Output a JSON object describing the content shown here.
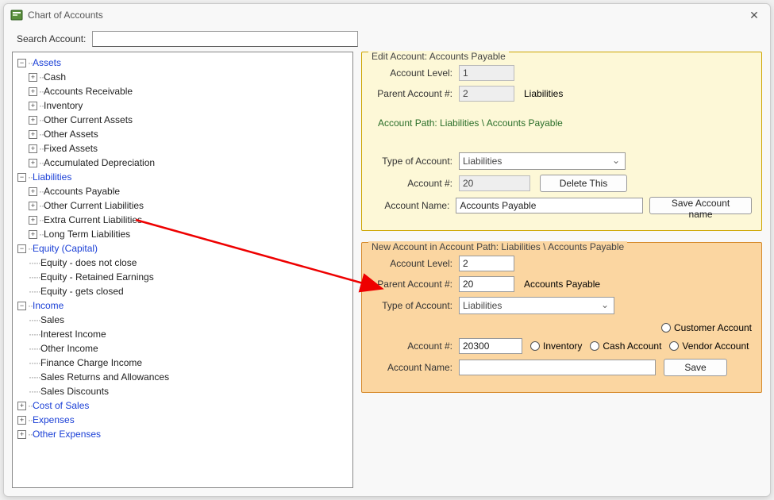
{
  "window": {
    "title": "Chart of Accounts"
  },
  "search": {
    "label": "Search Account:",
    "value": ""
  },
  "tree": {
    "assets": {
      "label": "Assets",
      "children": [
        "Cash",
        "Accounts Receivable",
        "Inventory",
        "Other Current Assets",
        "Other Assets",
        "Fixed Assets",
        "Accumulated Depreciation"
      ]
    },
    "liabilities": {
      "label": "Liabilities",
      "children": [
        "Accounts Payable",
        "Other Current Liabilities",
        "Extra Current Liabilities",
        "Long Term Liabilities"
      ]
    },
    "equity": {
      "label": "Equity (Capital)",
      "children": [
        "Equity - does not close",
        "Equity - Retained Earnings",
        "Equity - gets closed"
      ]
    },
    "income": {
      "label": "Income",
      "children": [
        "Sales",
        "Interest  Income",
        "Other Income",
        "Finance Charge Income",
        "Sales Returns and Allowances",
        "Sales Discounts"
      ]
    },
    "cost_of_sales": {
      "label": "Cost of Sales"
    },
    "expenses": {
      "label": "Expenses"
    },
    "other_expenses": {
      "label": "Other Expenses"
    }
  },
  "edit": {
    "legend": "Edit Account: Accounts Payable",
    "level_label": "Account Level:",
    "level": "1",
    "parent_label": "Parent Account #:",
    "parent_num": "2",
    "parent_name": "Liabilities",
    "path_label": "Account Path:  Liabilities \\ Accounts Payable",
    "type_label": "Type of Account:",
    "type_value": "Liabilities",
    "num_label": "Account #:",
    "num_value": "20",
    "delete_btn": "Delete This",
    "name_label": "Account Name:",
    "name_value": "Accounts Payable",
    "save_btn": "Save Account name"
  },
  "newacc": {
    "legend": "New Account in Account Path:  Liabilities \\ Accounts Payable",
    "level_label": "Account Level:",
    "level": "2",
    "parent_label": "Parent Account #:",
    "parent_num": "20",
    "parent_name": "Accounts Payable",
    "type_label": "Type of Account:",
    "type_value": "Liabilities",
    "num_label": "Account #:",
    "num_value": "20300",
    "name_label": "Account Name:",
    "name_value": "",
    "save_btn": "Save",
    "radio_customer": "Customer Account",
    "radio_inventory": "Inventory",
    "radio_cash": "Cash Account",
    "radio_vendor": "Vendor Account"
  }
}
